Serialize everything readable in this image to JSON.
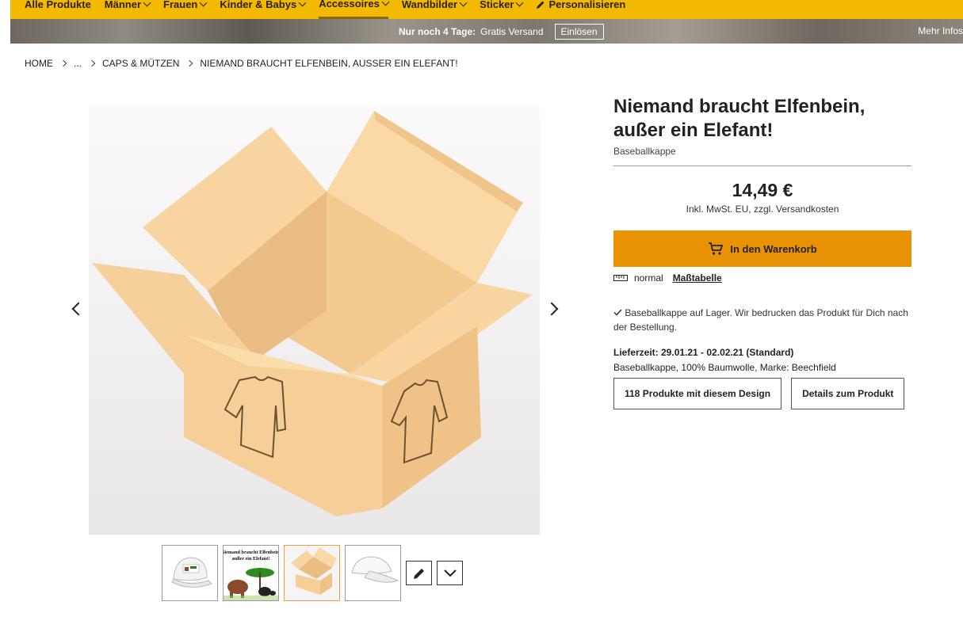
{
  "topnav": {
    "items": [
      {
        "label": "Alle Produkte"
      },
      {
        "label": "Männer"
      },
      {
        "label": "Frauen"
      },
      {
        "label": "Kinder & Babys"
      },
      {
        "label": "Accessoires"
      },
      {
        "label": "Wandbilder"
      },
      {
        "label": "Sticker"
      },
      {
        "label": "Personalisieren"
      }
    ]
  },
  "promo": {
    "strong": "Nur noch 4 Tage:",
    "text": "Gratis Versand",
    "button": "Einlösen",
    "more": "Mehr Infos"
  },
  "breadcrumb": {
    "home": "HOME",
    "ellipsis": "...",
    "category": "CAPS & MÜTZEN",
    "current": "NIEMAND BRAUCHT ELFENBEIN, AUSSER EIN ELEFANT!"
  },
  "product": {
    "title": "Niemand braucht Elfenbein, außer ein Elefant!",
    "subtitle": "Baseballkappe",
    "price": "14,49 €",
    "price_note": "Inkl. MwSt. EU, zzgl. Versandkosten",
    "cart_label": "In den Warenkorb",
    "size_label": "normal",
    "size_table": "Maßtabelle",
    "stock_text": "Baseballkappe auf Lager. Wir bedrucken das Produkt für Dich nach der Bestellung.",
    "delivery": "Lieferzeit: 29.01.21 - 02.02.21 (Standard)",
    "details_line": "Baseballkappe, 100% Baumwolle, Marke: Beechfield",
    "designs_button": "118 Produkte mit diesem Design",
    "details_button": "Details zum Produkt",
    "thumb_design_text": "Niemand braucht Elfenbein, außer ein Elefant!"
  },
  "colors": {
    "nav_bg": "#f2b900",
    "cart_bg": "#e99304",
    "active_thumb": "#e8a23d"
  }
}
